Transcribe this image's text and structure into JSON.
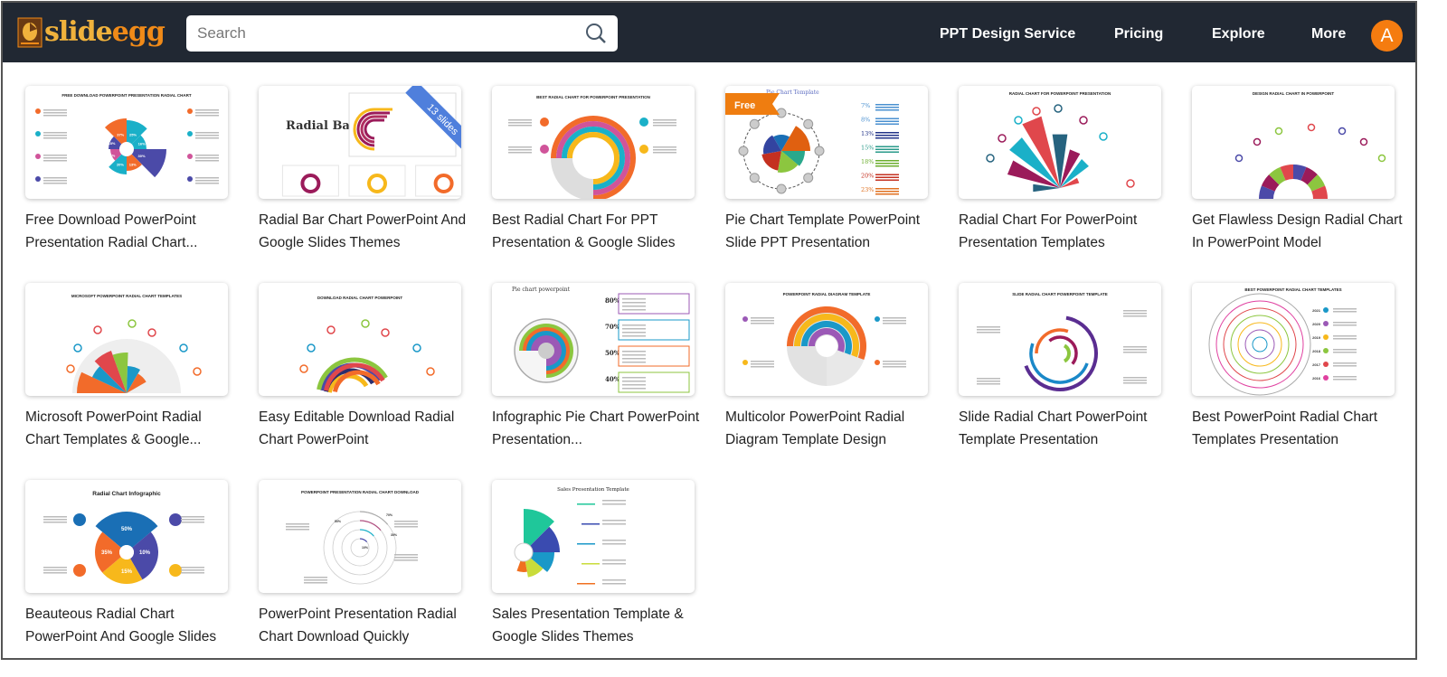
{
  "header": {
    "logo_text_a": "slide",
    "logo_text_b": "egg",
    "search_placeholder": "Search",
    "nav": [
      "PPT Design Service",
      "Pricing",
      "Explore",
      "More"
    ],
    "avatar_letter": "A",
    "avatar_color": "#f57c10"
  },
  "cards": [
    {
      "title": "Free Download PowerPoint Presentation Radial Chart...",
      "heading": "FREE DOWNLOAD POWERPOINT PRESENTATION RADIAL CHART",
      "kind": "petal",
      "labels": [
        "37%",
        "25%",
        "16%",
        "30%",
        "13%",
        "20%",
        "30%",
        "18%"
      ]
    },
    {
      "title": "Radial Bar Chart PowerPoint And Google Slides Themes",
      "heading": "Radial Bar Chart",
      "kind": "radialbar",
      "badge": "13 slides"
    },
    {
      "title": "Best Radial Chart For PPT Presentation & Google Slides",
      "heading": "BEST RADIAL CHART FOR POWERPOINT PRESENTATION",
      "kind": "rings"
    },
    {
      "title": "Pie Chart Template PowerPoint Slide PPT Presentation",
      "heading": "Pie Chart Template",
      "kind": "pie",
      "badge": "Free",
      "labels": [
        "7%",
        "8%",
        "13%",
        "15%",
        "18%",
        "20%",
        "23%"
      ]
    },
    {
      "title": "Radial Chart For PowerPoint Presentation Templates",
      "heading": "RADIAL CHART FOR POWERPOINT PRESENTATION",
      "kind": "fan"
    },
    {
      "title": "Get Flawless Design Radial Chart In PowerPoint Model",
      "heading": "DESIGN RADIAL CHART IN POWERPOINT",
      "kind": "halfring"
    },
    {
      "title": "Microsoft PowerPoint Radial Chart Templates & Google...",
      "heading": "MICROSOFT POWERPOINT RADIAL CHART TEMPLATES",
      "kind": "fan2"
    },
    {
      "title": "Easy Editable Download Radial Chart PowerPoint",
      "heading": "DOWNLOAD RADIAL CHART POWERPOINT",
      "kind": "arcs"
    },
    {
      "title": "Infographic Pie Chart PowerPoint Presentation...",
      "heading": "Pie chart powerpoint",
      "kind": "piebars",
      "labels": [
        "80%",
        "70%",
        "50%",
        "40%"
      ]
    },
    {
      "title": "Multicolor PowerPoint Radial Diagram Template Design",
      "heading": "POWERPOINT RADIAL DIAGRAM TEMPLATE",
      "kind": "diagram"
    },
    {
      "title": "Slide Radial Chart PowerPoint Template Presentation",
      "heading": "SLIDE RADIAL CHART POWERPOINT TEMPLATE",
      "kind": "spiral"
    },
    {
      "title": "Best PowerPoint Radial Chart Templates Presentation",
      "heading": "BEST POWERPOINT RADIAL CHART TEMPLATES",
      "kind": "circles",
      "labels": [
        "2021",
        "2020",
        "2019",
        "2018",
        "2017",
        "2016"
      ]
    },
    {
      "title": "Beauteous Radial Chart PowerPoint And Google Slides",
      "heading": "Radial Chart Infographic",
      "kind": "donut4",
      "labels": [
        "50%",
        "10%",
        "15%",
        "35%"
      ]
    },
    {
      "title": "PowerPoint Presentation Radial Chart Download Quickly",
      "heading": "POWERPOINT PRESENTATION RADIAL CHART DOWNLOAD",
      "kind": "thinrings",
      "labels": [
        "10%",
        "30%",
        "50%",
        "70%"
      ]
    },
    {
      "title": "Sales Presentation Template & Google Slides Themes",
      "heading": "Sales Presentation Template",
      "kind": "sales"
    }
  ]
}
